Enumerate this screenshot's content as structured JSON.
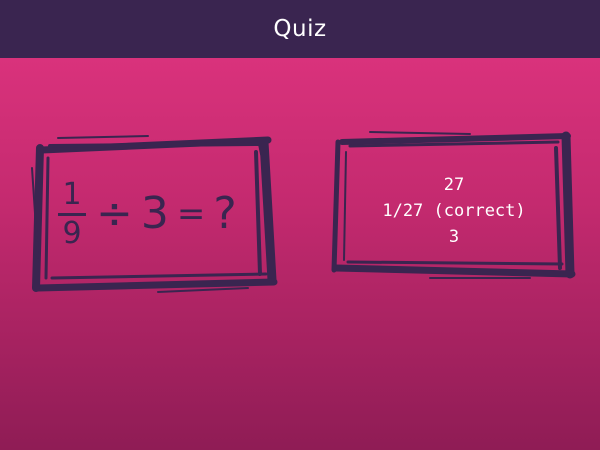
{
  "header": {
    "title": "Quiz"
  },
  "question": {
    "numerator": "1",
    "denominator": "9",
    "operator": "÷",
    "operand": "3",
    "equals": "=",
    "unknown": "?"
  },
  "answers": {
    "options": [
      "27",
      "1/27 (correct)",
      "3"
    ]
  },
  "colors": {
    "header_bg": "#3a2550",
    "frame": "#3a2550",
    "background_top": "#e23581",
    "background_bottom": "#8f1c55",
    "text": "#ffffff"
  }
}
